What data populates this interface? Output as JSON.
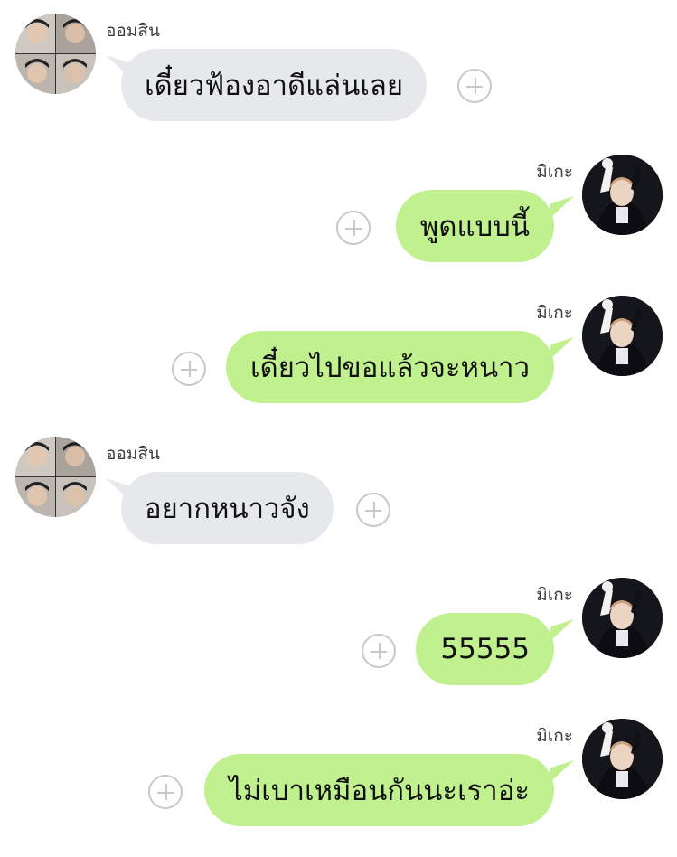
{
  "messages": [
    {
      "side": "left",
      "sender": "ออมสิน",
      "text": "เดี๋ยวฟ้องอาดีแล่นเลย"
    },
    {
      "side": "right",
      "sender": "มิเกะ",
      "text": "พูดแบบนี้"
    },
    {
      "side": "right",
      "sender": "มิเกะ",
      "text": "เดี๋ยวไปขอแล้วจะหนาว"
    },
    {
      "side": "left",
      "sender": "ออมสิน",
      "text": "อยากหนาวจัง"
    },
    {
      "side": "right",
      "sender": "มิเกะ",
      "text": "55555"
    },
    {
      "side": "right",
      "sender": "มิเกะ",
      "text": "ไม่เบาเหมือนกันนะเราอ่ะ"
    }
  ],
  "icons": {
    "add": "plus-circle-icon",
    "avatar_left": "avatar-photo-icon",
    "avatar_right": "avatar-photo-icon"
  },
  "colors": {
    "incoming_bubble": "#e6e8ec",
    "outgoing_bubble": "#c1f08e",
    "plus_icon": "#c8c8c8"
  }
}
